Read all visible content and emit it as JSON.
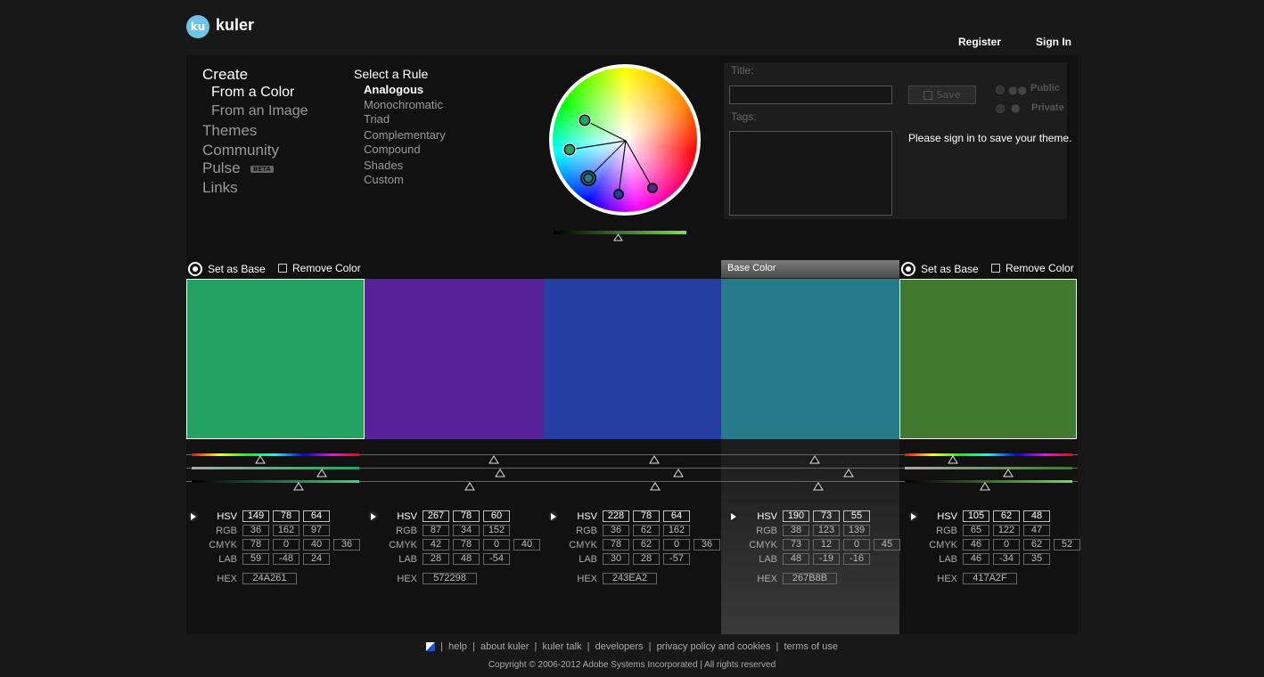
{
  "brand": {
    "badge": "ku",
    "name": "kuler"
  },
  "topnav": {
    "register": "Register",
    "signin": "Sign In"
  },
  "nav": {
    "create": "Create",
    "from_color": "From a Color",
    "from_image": "From an Image",
    "themes": "Themes",
    "community": "Community",
    "pulse": "Pulse",
    "beta": "BETA",
    "links": "Links"
  },
  "rules": {
    "title": "Select a Rule",
    "items": [
      "Analogous",
      "Monochromatic",
      "Triad",
      "Complementary",
      "Compound",
      "Shades",
      "Custom"
    ]
  },
  "save": {
    "title_label": "Title:",
    "tags_label": "Tags:",
    "save_button": "Save",
    "public": "Public",
    "private": "Private",
    "signin_msg": "Please sign in to save your theme."
  },
  "actions": {
    "set_base": "Set as Base",
    "remove": "Remove Color",
    "base_color": "Base Color"
  },
  "labels": {
    "hsv": "HSV",
    "rgb": "RGB",
    "cmyk": "CMYK",
    "lab": "LAB",
    "hex": "HEX"
  },
  "swatches": [
    {
      "color": "#24A261",
      "hsv": [
        "149",
        "78",
        "64"
      ],
      "rgb": [
        "36",
        "162",
        "97"
      ],
      "cmyk": [
        "78",
        "0",
        "40",
        "36"
      ],
      "lab": [
        "59",
        "-48",
        "24"
      ],
      "hex": "24A261"
    },
    {
      "color": "#572298",
      "hsv": [
        "267",
        "78",
        "60"
      ],
      "rgb": [
        "87",
        "34",
        "152"
      ],
      "cmyk": [
        "42",
        "78",
        "0",
        "40"
      ],
      "lab": [
        "28",
        "48",
        "-54"
      ],
      "hex": "572298"
    },
    {
      "color": "#243EA2",
      "hsv": [
        "228",
        "78",
        "64"
      ],
      "rgb": [
        "36",
        "62",
        "162"
      ],
      "cmyk": [
        "78",
        "62",
        "0",
        "36"
      ],
      "lab": [
        "30",
        "28",
        "-57"
      ],
      "hex": "243EA2"
    },
    {
      "color": "#267B8B",
      "hsv": [
        "190",
        "73",
        "55"
      ],
      "rgb": [
        "38",
        "123",
        "139"
      ],
      "cmyk": [
        "73",
        "12",
        "0",
        "45"
      ],
      "lab": [
        "48",
        "-19",
        "-16"
      ],
      "hex": "267B8B"
    },
    {
      "color": "#417A2F",
      "hsv": [
        "105",
        "62",
        "48"
      ],
      "rgb": [
        "65",
        "122",
        "47"
      ],
      "cmyk": [
        "46",
        "0",
        "62",
        "52"
      ],
      "lab": [
        "46",
        "-34",
        "35"
      ],
      "hex": "417A2F"
    }
  ],
  "footer": {
    "links": [
      "help",
      "about kuler",
      "kuler talk",
      "developers",
      "privacy policy and cookies",
      "terms of use"
    ],
    "copyright": "Copyright © 2006-2012 Adobe Systems Incorporated | All rights reserved"
  }
}
